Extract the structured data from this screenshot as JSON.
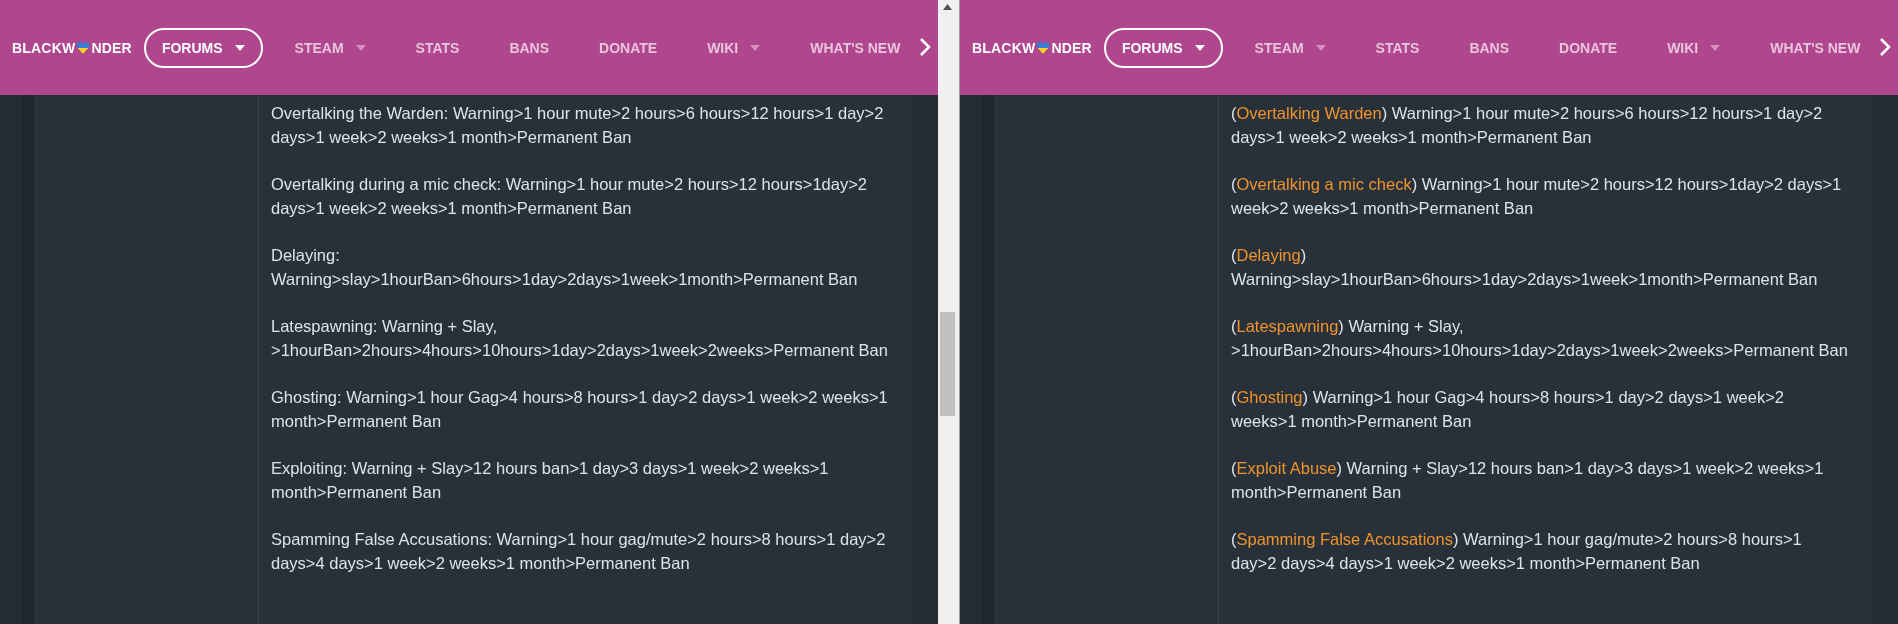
{
  "panes": [
    {
      "nav": {
        "logo_start": "BLACKW",
        "logo_end": "NDER",
        "items": [
          {
            "label": "FORUMS",
            "selected": true,
            "caret": true
          },
          {
            "label": "STEAM",
            "selected": false,
            "caret": true
          },
          {
            "label": "STATS",
            "selected": false,
            "caret": false
          },
          {
            "label": "BANS",
            "selected": false,
            "caret": false
          },
          {
            "label": "DONATE",
            "selected": false,
            "caret": false
          },
          {
            "label": "WIKI",
            "selected": false,
            "caret": true
          },
          {
            "label": "WHAT'S NEW",
            "selected": false,
            "caret": false
          }
        ]
      },
      "rules": [
        {
          "kind": "plain",
          "text": "Overtalking the Warden: Warning>1 hour mute>2 hours>6 hours>12 hours>1 day>2 days>1 week>2 weeks>1 month>Permanent Ban"
        },
        {
          "kind": "plain",
          "text": "Overtalking during a mic check: Warning>1 hour mute>2 hours>12 hours>1day>2 days>1 week>2 weeks>1 month>Permanent Ban"
        },
        {
          "kind": "plain",
          "text": "Delaying: Warning>slay>1hourBan>6hours>1day>2days>1week>1month>Permanent Ban"
        },
        {
          "kind": "plain",
          "text": "Latespawning: Warning + Slay, >1hourBan>2hours>4hours>10hours>1day>2days>1week>2weeks>Permanent Ban"
        },
        {
          "kind": "plain",
          "text": "Ghosting: Warning>1 hour Gag>4 hours>8 hours>1 day>2 days>1 week>2 weeks>1 month>Permanent Ban"
        },
        {
          "kind": "plain",
          "text": "Exploiting: Warning + Slay>12 hours ban>1 day>3 days>1 week>2 weeks>1 month>Permanent Ban"
        },
        {
          "kind": "plain",
          "text": "Spamming False Accusations: Warning>1 hour gag/mute>2 hours>8 hours>1 day>2 days>4 days>1 week>2 weeks>1 month>Permanent Ban"
        }
      ]
    },
    {
      "nav": {
        "logo_start": "BLACKW",
        "logo_end": "NDER",
        "items": [
          {
            "label": "FORUMS",
            "selected": true,
            "caret": true
          },
          {
            "label": "STEAM",
            "selected": false,
            "caret": true
          },
          {
            "label": "STATS",
            "selected": false,
            "caret": false
          },
          {
            "label": "BANS",
            "selected": false,
            "caret": false
          },
          {
            "label": "DONATE",
            "selected": false,
            "caret": false
          },
          {
            "label": "WIKI",
            "selected": false,
            "caret": true
          },
          {
            "label": "WHAT'S NEW",
            "selected": false,
            "caret": false
          }
        ]
      },
      "rules": [
        {
          "kind": "labelled",
          "prefix": "(",
          "label": "Overtalking Warden",
          "text": ") Warning>1 hour mute>2 hours>6 hours>12 hours>1 day>2 days>1 week>2 weeks>1 month>Permanent Ban"
        },
        {
          "kind": "labelled",
          "prefix": "(",
          "label": "Overtalking a mic check",
          "text": ") Warning>1 hour mute>2 hours>12 hours>1day>2 days>1 week>2 weeks>1 month>Permanent Ban"
        },
        {
          "kind": "labelled",
          "prefix": "(",
          "label": "Delaying",
          "text": ") Warning>slay>1hourBan>6hours>1day>2days>1week>1month>Permanent Ban"
        },
        {
          "kind": "labelled",
          "prefix": "(",
          "label": "Latespawning",
          "text": ") Warning + Slay, >1hourBan>2hours>4hours>10hours>1day>2days>1week>2weeks>Permanent Ban"
        },
        {
          "kind": "labelled",
          "prefix": "(",
          "label": "Ghosting",
          "text": ") Warning>1 hour Gag>4 hours>8 hours>1 day>2 days>1 week>2 weeks>1 month>Permanent Ban"
        },
        {
          "kind": "labelled",
          "prefix": "(",
          "label": "Exploit Abuse",
          "text": ") Warning + Slay>12 hours ban>1 day>3 days>1 week>2 weeks>1 month>Permanent Ban"
        },
        {
          "kind": "labelled",
          "prefix": "(",
          "label": "Spamming False Accusations",
          "text": ") Warning>1 hour gag/mute>2 hours>8 hours>1 day>2 days>4 days>1 week>2 weeks>1 month>Permanent Ban"
        }
      ]
    }
  ]
}
